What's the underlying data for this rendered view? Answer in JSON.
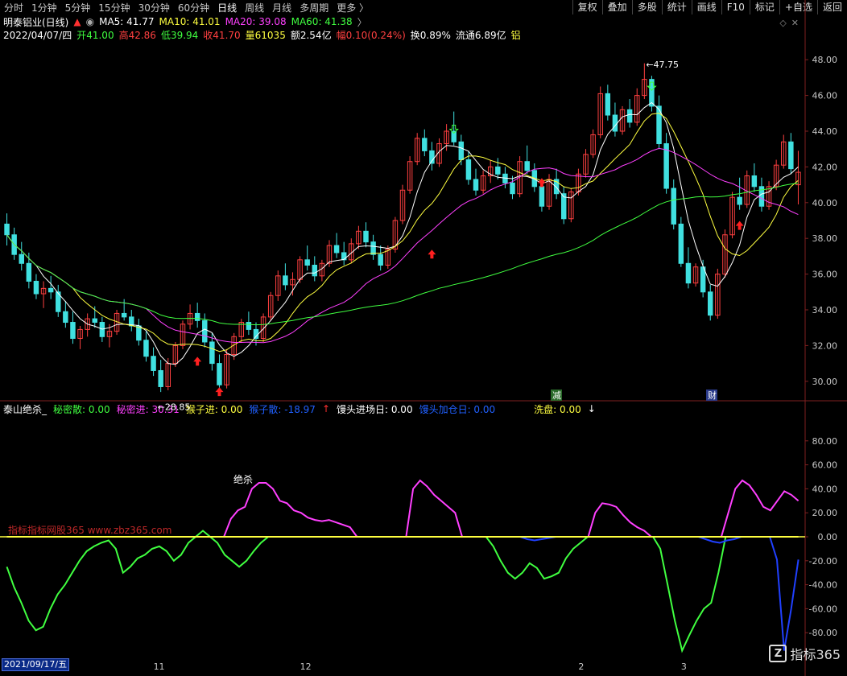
{
  "toolbar": {
    "periods": [
      "分时",
      "1分钟",
      "5分钟",
      "15分钟",
      "30分钟",
      "60分钟",
      "日线",
      "周线",
      "月线",
      "多周期",
      "更多 〉"
    ],
    "active": "日线",
    "right_buttons": [
      "复权",
      "叠加",
      "多股",
      "统计",
      "画线",
      "F10",
      "标记",
      "+自选",
      "返回"
    ]
  },
  "header": {
    "stock": "明泰铝业(日线)",
    "ma5": "MA5: 41.77",
    "ma10": "MA10: 41.01",
    "ma20": "MA20: 39.08",
    "ma60": "MA60: 41.38"
  },
  "ohlc": {
    "date": "2022/04/07/四",
    "open": "开41.00",
    "high": "高42.86",
    "low": "低39.94",
    "close": "收41.70",
    "vol": "量61035",
    "amount": "额2.54亿",
    "change": "幅0.10(0.24%)",
    "turnover": "换0.89%",
    "float": "流通6.89亿",
    "sector": "铝"
  },
  "indicator": {
    "name": "泰山绝杀_",
    "mimi_san": "秘密散: 0.00",
    "mimi_jin": "秘密进: 30.31",
    "houzi_jin": "猴子进: 0.00",
    "houzi_san": "猴子散: -18.97",
    "mantou_jin": "馒头进场日: 0.00",
    "mantou_jia": "馒头加仓日: 0.00",
    "xipan": "洗盘: 0.00"
  },
  "labels": {
    "low_marker": "←28.85",
    "high_marker": "←47.75",
    "juesha": "绝杀",
    "jian": "减",
    "cai": "财",
    "date_cursor": "2021/09/17/五",
    "watermark": "指标指标网股365 www.zbz365.com",
    "logo_text": "指标365",
    "logo_mark": "Z"
  },
  "colors": {
    "bg": "#000000",
    "up": "#ff4040",
    "down": "#40e0e0",
    "ma5": "#ffffff",
    "ma10": "#ffff40",
    "ma20": "#ff40ff",
    "ma60": "#40ff40",
    "green_line": "#40ff40",
    "magenta_line": "#ff40ff",
    "blue_line": "#2040ff",
    "yellow_line": "#ffff40",
    "axis_text": "#c8c8c8",
    "grid": "#802020"
  },
  "chart_data": [
    {
      "type": "candlestick",
      "title": "明泰铝业(日线)",
      "ylim": [
        29,
        49
      ],
      "y_ticks": [
        30.0,
        32.0,
        34.0,
        36.0,
        38.0,
        40.0,
        42.0,
        44.0,
        46.0,
        48.0
      ],
      "x_tick_labels": [
        "11",
        "12",
        "2",
        "3"
      ],
      "candles": [
        [
          38.8,
          39.4,
          37.6,
          38.2
        ],
        [
          38.2,
          38.6,
          36.8,
          37.1
        ],
        [
          37.1,
          37.8,
          36.2,
          36.6
        ],
        [
          36.6,
          37.2,
          35.2,
          35.6
        ],
        [
          35.6,
          36.0,
          34.6,
          34.9
        ],
        [
          34.9,
          35.6,
          34.1,
          35.2
        ],
        [
          35.2,
          35.9,
          34.6,
          35.0
        ],
        [
          35.0,
          35.4,
          33.6,
          33.9
        ],
        [
          33.9,
          34.5,
          33.0,
          33.3
        ],
        [
          33.3,
          33.9,
          32.1,
          32.4
        ],
        [
          32.4,
          33.1,
          31.8,
          32.9
        ],
        [
          32.9,
          33.8,
          32.5,
          33.5
        ],
        [
          33.5,
          34.2,
          33.0,
          33.3
        ],
        [
          33.3,
          33.6,
          32.2,
          32.5
        ],
        [
          32.5,
          33.2,
          31.9,
          32.8
        ],
        [
          32.8,
          34.0,
          32.6,
          33.8
        ],
        [
          33.8,
          34.6,
          33.4,
          33.6
        ],
        [
          33.6,
          34.0,
          32.8,
          33.1
        ],
        [
          33.1,
          33.5,
          32.0,
          32.3
        ],
        [
          32.3,
          32.8,
          31.1,
          31.4
        ],
        [
          31.4,
          31.9,
          30.3,
          30.6
        ],
        [
          30.6,
          31.2,
          29.4,
          29.7
        ],
        [
          29.7,
          31.3,
          29.5,
          31.0
        ],
        [
          31.0,
          32.2,
          30.8,
          32.0
        ],
        [
          32.0,
          33.4,
          31.8,
          33.2
        ],
        [
          33.2,
          34.3,
          32.9,
          33.8
        ],
        [
          33.8,
          34.4,
          33.0,
          33.4
        ],
        [
          33.4,
          33.8,
          31.9,
          32.2
        ],
        [
          32.2,
          32.7,
          30.6,
          31.0
        ],
        [
          31.0,
          31.5,
          29.4,
          29.8
        ],
        [
          29.8,
          31.8,
          29.6,
          31.5
        ],
        [
          31.5,
          32.7,
          31.2,
          32.5
        ],
        [
          32.5,
          33.5,
          32.2,
          33.3
        ],
        [
          33.3,
          33.9,
          32.6,
          32.9
        ],
        [
          32.9,
          33.3,
          32.0,
          32.4
        ],
        [
          32.4,
          33.8,
          32.2,
          33.6
        ],
        [
          33.6,
          35.0,
          33.4,
          34.8
        ],
        [
          34.8,
          36.2,
          34.5,
          35.9
        ],
        [
          35.9,
          36.6,
          35.1,
          35.4
        ],
        [
          35.4,
          36.1,
          34.8,
          35.7
        ],
        [
          35.7,
          37.0,
          35.5,
          36.8
        ],
        [
          36.8,
          37.6,
          36.2,
          36.5
        ],
        [
          36.5,
          37.0,
          35.6,
          35.9
        ],
        [
          35.9,
          36.8,
          35.6,
          36.6
        ],
        [
          36.6,
          37.9,
          36.4,
          37.6
        ],
        [
          37.6,
          38.3,
          36.9,
          37.2
        ],
        [
          37.2,
          37.8,
          36.5,
          36.8
        ],
        [
          36.8,
          38.0,
          36.6,
          37.7
        ],
        [
          37.7,
          38.7,
          37.4,
          38.4
        ],
        [
          38.4,
          38.9,
          37.5,
          37.8
        ],
        [
          37.8,
          38.2,
          36.8,
          37.1
        ],
        [
          37.1,
          37.6,
          36.2,
          36.5
        ],
        [
          36.5,
          37.6,
          36.3,
          37.4
        ],
        [
          37.4,
          39.2,
          37.2,
          39.0
        ],
        [
          39.0,
          41.0,
          38.8,
          40.7
        ],
        [
          40.7,
          42.6,
          40.5,
          42.3
        ],
        [
          42.3,
          43.9,
          42.1,
          43.6
        ],
        [
          43.6,
          44.1,
          42.6,
          42.9
        ],
        [
          42.9,
          43.4,
          41.8,
          42.2
        ],
        [
          42.2,
          43.6,
          42.0,
          43.3
        ],
        [
          43.3,
          44.4,
          42.9,
          44.0
        ],
        [
          44.0,
          45.1,
          43.2,
          43.4
        ],
        [
          43.4,
          43.8,
          42.1,
          42.4
        ],
        [
          42.4,
          42.9,
          41.0,
          41.3
        ],
        [
          41.3,
          41.9,
          40.4,
          40.7
        ],
        [
          40.7,
          41.8,
          40.5,
          41.5
        ],
        [
          41.5,
          42.4,
          41.1,
          42.0
        ],
        [
          42.0,
          42.5,
          41.3,
          41.6
        ],
        [
          41.6,
          42.0,
          40.8,
          41.1
        ],
        [
          41.1,
          41.5,
          40.2,
          40.5
        ],
        [
          40.5,
          42.6,
          40.3,
          42.3
        ],
        [
          42.3,
          43.2,
          41.6,
          41.8
        ],
        [
          41.8,
          42.2,
          40.6,
          40.9
        ],
        [
          40.9,
          41.3,
          39.5,
          39.8
        ],
        [
          39.8,
          41.6,
          39.6,
          41.3
        ],
        [
          41.3,
          41.9,
          40.2,
          40.5
        ],
        [
          40.5,
          40.9,
          38.8,
          39.1
        ],
        [
          39.1,
          40.8,
          38.9,
          40.6
        ],
        [
          40.6,
          41.9,
          40.4,
          41.6
        ],
        [
          41.6,
          43.0,
          41.4,
          42.7
        ],
        [
          42.7,
          44.1,
          42.5,
          43.8
        ],
        [
          43.8,
          46.5,
          43.6,
          46.1
        ],
        [
          46.1,
          46.6,
          44.6,
          44.9
        ],
        [
          44.9,
          45.6,
          43.7,
          44.0
        ],
        [
          44.0,
          45.4,
          43.8,
          45.2
        ],
        [
          45.2,
          45.8,
          44.2,
          44.5
        ],
        [
          44.5,
          46.4,
          44.3,
          46.0
        ],
        [
          46.0,
          47.8,
          45.8,
          46.9
        ],
        [
          46.9,
          47.1,
          45.1,
          45.4
        ],
        [
          45.4,
          46.0,
          43.0,
          43.3
        ],
        [
          43.3,
          43.9,
          40.5,
          40.8
        ],
        [
          40.8,
          41.3,
          38.5,
          38.8
        ],
        [
          38.8,
          39.2,
          36.4,
          36.6
        ],
        [
          36.6,
          37.5,
          35.2,
          35.5
        ],
        [
          35.5,
          36.6,
          35.3,
          36.4
        ],
        [
          36.4,
          36.8,
          34.7,
          35.0
        ],
        [
          35.0,
          35.4,
          33.4,
          33.7
        ],
        [
          33.7,
          36.3,
          33.5,
          36.0
        ],
        [
          36.0,
          38.5,
          35.8,
          38.2
        ],
        [
          38.2,
          40.6,
          38.0,
          40.3
        ],
        [
          40.3,
          41.4,
          39.6,
          39.9
        ],
        [
          39.9,
          41.8,
          39.7,
          41.5
        ],
        [
          41.5,
          42.2,
          40.6,
          40.9
        ],
        [
          40.9,
          41.4,
          39.5,
          39.8
        ],
        [
          39.8,
          41.2,
          39.6,
          40.9
        ],
        [
          40.9,
          42.4,
          40.7,
          42.1
        ],
        [
          42.1,
          43.8,
          41.9,
          43.4
        ],
        [
          43.4,
          43.9,
          41.6,
          41.9
        ],
        [
          41.0,
          42.9,
          39.9,
          41.7
        ]
      ],
      "overlays": [
        {
          "name": "MA5",
          "value": 41.77
        },
        {
          "name": "MA10",
          "value": 41.01
        },
        {
          "name": "MA20",
          "value": 39.08
        },
        {
          "name": "MA60",
          "value": 41.38
        }
      ],
      "annotations": [
        {
          "text": "←28.85",
          "value": 28.85
        },
        {
          "text": "←47.75",
          "value": 47.75
        },
        {
          "text": "减"
        },
        {
          "text": "财"
        }
      ]
    },
    {
      "type": "line",
      "title": "泰山绝杀_",
      "ylim": [
        -100,
        100
      ],
      "y_ticks": [
        80.0,
        60.0,
        40.0,
        20.0,
        0.0,
        -20.0,
        -40.0,
        -60.0,
        -80.0
      ],
      "series": [
        {
          "name": "秘密散",
          "values": [
            -25,
            -42,
            -55,
            -70,
            -78,
            -75,
            -60,
            -48,
            -40,
            -30,
            -20,
            -12,
            -8,
            -5,
            -3,
            -10,
            -30,
            -25,
            -18,
            -15,
            -10,
            -8,
            -12,
            -20,
            -15,
            -5,
            0,
            5,
            0,
            -5,
            -15,
            -20,
            -25,
            -20,
            -12,
            -5,
            0,
            0,
            0,
            0,
            0,
            0,
            0,
            0,
            0,
            0,
            0,
            0,
            0,
            0,
            0,
            0,
            0,
            0,
            0,
            0,
            0,
            0,
            0,
            0,
            0,
            0,
            0,
            0,
            0,
            0,
            0,
            -8,
            -20,
            -30,
            -35,
            -30,
            -22,
            -26,
            -35,
            -33,
            -30,
            -18,
            -10,
            -5,
            0,
            0,
            0,
            0,
            0,
            0,
            0,
            0,
            0,
            0,
            -10,
            -40,
            -70,
            -95,
            -82,
            -70,
            -60,
            -55,
            -30,
            0,
            0,
            0,
            0,
            0,
            0,
            0,
            0,
            0,
            0,
            0
          ]
        },
        {
          "name": "秘密进",
          "values": [
            0,
            0,
            0,
            0,
            0,
            0,
            0,
            0,
            0,
            0,
            0,
            0,
            0,
            0,
            0,
            0,
            0,
            0,
            0,
            0,
            0,
            0,
            0,
            0,
            0,
            0,
            0,
            0,
            0,
            0,
            0,
            0,
            15,
            22,
            25,
            40,
            45,
            45,
            40,
            30,
            28,
            22,
            20,
            16,
            14,
            13,
            14,
            12,
            10,
            8,
            0,
            0,
            0,
            0,
            0,
            0,
            0,
            0,
            40,
            47,
            42,
            35,
            30,
            25,
            20,
            0,
            0,
            0,
            0,
            0,
            0,
            0,
            0,
            0,
            0,
            0,
            0,
            0,
            0,
            0,
            0,
            0,
            0,
            0,
            20,
            28,
            27,
            25,
            18,
            12,
            8,
            5,
            0,
            0,
            0,
            0,
            0,
            0,
            0,
            0,
            0,
            0,
            0,
            20,
            40,
            47,
            43,
            35,
            25,
            22,
            30,
            38,
            35,
            30
          ]
        },
        {
          "name": "猴子散",
          "values": [
            0,
            0,
            0,
            0,
            0,
            0,
            0,
            0,
            0,
            0,
            0,
            0,
            0,
            0,
            0,
            0,
            0,
            0,
            0,
            0,
            0,
            0,
            0,
            0,
            0,
            0,
            0,
            0,
            0,
            0,
            0,
            0,
            0,
            0,
            0,
            0,
            0,
            0,
            0,
            0,
            0,
            0,
            0,
            0,
            0,
            0,
            0,
            0,
            0,
            0,
            0,
            0,
            0,
            0,
            0,
            0,
            0,
            0,
            0,
            0,
            0,
            0,
            0,
            0,
            0,
            0,
            0,
            0,
            0,
            0,
            0,
            0,
            0,
            -2,
            -3,
            -2,
            -1,
            0,
            0,
            0,
            0,
            0,
            0,
            0,
            0,
            0,
            0,
            0,
            0,
            0,
            0,
            0,
            0,
            0,
            0,
            0,
            0,
            0,
            -2,
            -4,
            -5,
            -3,
            -2,
            0,
            0,
            0,
            0,
            0,
            -19,
            -95,
            -60,
            -19
          ]
        },
        {
          "name": "猴子进",
          "values": [
            0,
            0,
            0,
            0,
            0,
            0,
            0,
            0,
            0,
            0,
            0,
            0,
            0,
            0,
            0,
            0,
            0,
            0,
            0,
            0,
            0,
            0,
            0,
            0,
            0,
            0,
            0,
            0,
            0,
            0,
            0,
            0,
            0,
            0,
            0,
            0,
            0,
            0,
            0,
            0,
            0,
            0,
            0,
            0,
            0,
            0,
            0,
            0,
            0,
            0,
            0,
            0,
            0,
            0,
            0,
            0,
            0,
            0,
            0,
            0,
            0,
            0,
            0,
            0,
            0,
            0,
            0,
            0,
            0,
            0,
            0,
            0,
            0,
            0,
            0,
            0,
            0,
            0,
            0,
            0,
            0,
            0,
            0,
            0,
            0,
            0,
            0,
            0,
            0,
            0,
            0,
            0,
            0,
            0,
            0,
            0,
            0,
            0,
            0,
            0,
            0,
            0,
            0,
            0,
            0,
            0,
            0,
            0,
            0,
            0,
            0,
            0
          ]
        }
      ]
    }
  ]
}
